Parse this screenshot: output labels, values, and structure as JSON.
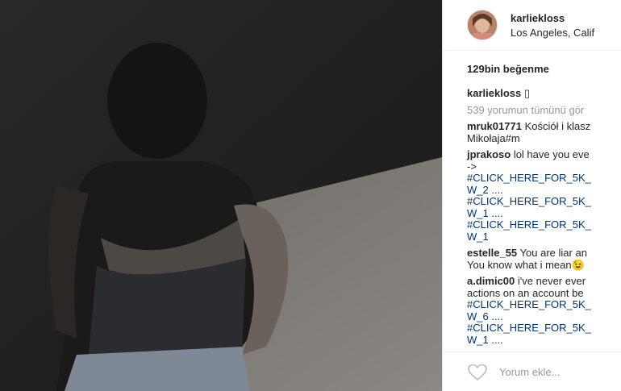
{
  "post": {
    "username": "karliekloss",
    "location": "Los Angeles, Calif",
    "likes": "129bin beğenme",
    "caption_user": "karliekloss",
    "caption_icon": "▯",
    "view_all": "539 yorumun tümünü gör"
  },
  "comments": [
    {
      "user": "mruk01771",
      "lines": [
        "Kościół i klasz",
        "Mikołaja#m"
      ]
    },
    {
      "user": "jprakoso",
      "lines": [
        "lol have you eve",
        "->"
      ],
      "links": [
        "#CLICK_HERE_FOR_5K_",
        "W_2 ....",
        "#CLICK_HERE_FOR_5K_",
        "W_1 ....",
        "#CLICK_HERE_FOR_5K_",
        "W_1"
      ]
    },
    {
      "user": "estelle_55",
      "lines": [
        "You are liar an",
        "You know what i mean😉"
      ]
    },
    {
      "user": "a.dimic00",
      "lines": [
        "i've never ever",
        "actions on an account be"
      ],
      "links": [
        "#CLICK_HERE_FOR_5K_",
        "W_6 ....",
        "#CLICK_HERE_FOR_5K_",
        "W_1 ...."
      ]
    }
  ],
  "footer": {
    "add_comment_placeholder": "Yorum ekle..."
  },
  "icons": {
    "like": "heart-icon"
  }
}
